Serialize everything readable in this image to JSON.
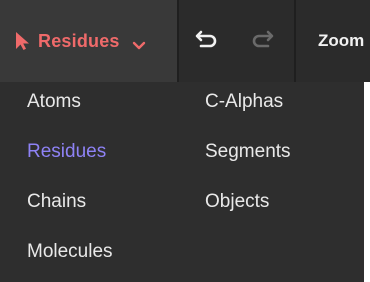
{
  "toolbar": {
    "mode_label": "Residues",
    "mode_color": "#ef6a6a",
    "mode_icon": "pointer-icon",
    "dropdown_icon": "chevron-down-icon",
    "undo_icon": "undo-icon",
    "redo_icon": "redo-icon",
    "zoom_label": "Zoom"
  },
  "selection_menu": {
    "selected": "Residues",
    "accent_color": "#8e82f5",
    "items": [
      {
        "label": "Atoms"
      },
      {
        "label": "Residues"
      },
      {
        "label": "Chains"
      },
      {
        "label": "Molecules"
      },
      {
        "label": "C-Alphas"
      },
      {
        "label": "Segments"
      },
      {
        "label": "Objects"
      }
    ]
  }
}
